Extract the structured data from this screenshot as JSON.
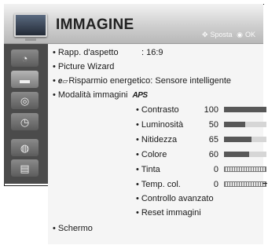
{
  "header": {
    "title": "IMMAGINE",
    "hint_move": "Sposta",
    "hint_ok": "OK",
    "icon": "tv-picture-icon"
  },
  "sidebar": {
    "items": [
      {
        "icon": "satellite-dish-icon",
        "glyph": "◔",
        "selected": false
      },
      {
        "icon": "tv-picture-icon",
        "glyph": "▬",
        "selected": true
      },
      {
        "icon": "audio-icon",
        "glyph": "◎",
        "selected": false
      },
      {
        "icon": "clock-icon",
        "glyph": "◷",
        "selected": false
      },
      {
        "icon": "lock-icon",
        "glyph": "◍",
        "selected": false
      },
      {
        "icon": "options-icon",
        "glyph": "▤",
        "selected": false
      }
    ]
  },
  "menu": {
    "aspect": {
      "label": "Rapp. d'aspetto",
      "value": ": 16:9"
    },
    "picture_wizard": "Picture Wizard",
    "energy": {
      "prefix": "e",
      "label": "Risparmio energetico: Sensore intelligente"
    },
    "picture_mode": {
      "label": "Modalità immagini",
      "badge": "APS"
    },
    "settings": [
      {
        "label": "Contrasto",
        "value": "100",
        "level": 100,
        "style": "solid"
      },
      {
        "label": "Luminosità",
        "value": "50",
        "level": 50,
        "style": "solid"
      },
      {
        "label": "Nitidezza",
        "value": "65",
        "level": 65,
        "style": "solid"
      },
      {
        "label": "Colore",
        "value": "60",
        "level": 60,
        "style": "solid"
      },
      {
        "label": "Tinta",
        "value": "0",
        "level": 0,
        "style": "hatch"
      },
      {
        "label": "Temp. col.",
        "value": "0",
        "level": 0,
        "style": "hatch"
      }
    ],
    "advanced": "Controllo avanzato",
    "reset": "Reset immagini",
    "screen": "Schermo"
  },
  "colors": {
    "sidebar": "#4b4b4b",
    "panel": "#f5f5f5",
    "bar_fill": "#585858"
  }
}
